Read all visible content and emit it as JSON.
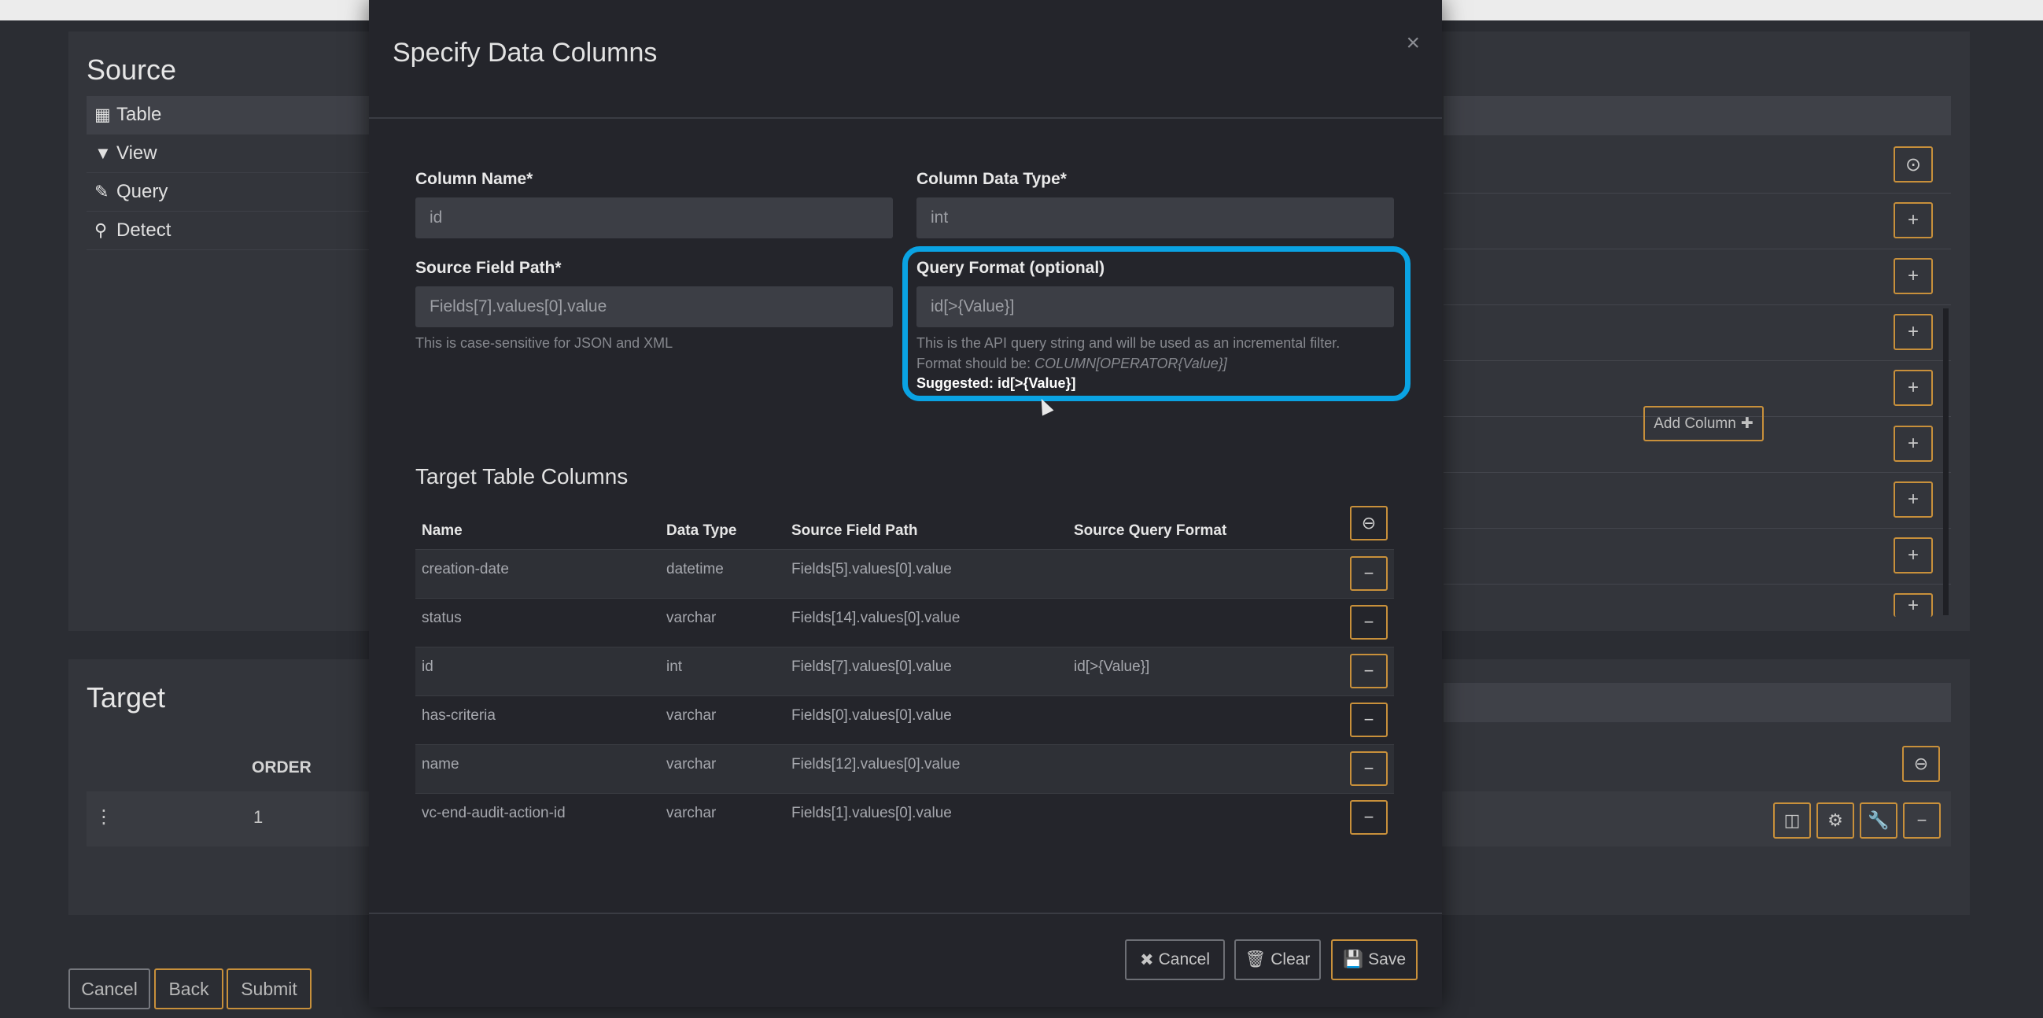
{
  "background": {
    "source": {
      "title": "Source",
      "menu": [
        {
          "icon": "table-icon",
          "glyph": "▦",
          "label": "Table"
        },
        {
          "icon": "filter-icon",
          "glyph": "▼",
          "label": "View"
        },
        {
          "icon": "edit-icon",
          "glyph": "✎",
          "label": "Query"
        },
        {
          "icon": "search-icon",
          "glyph": "⚲",
          "label": "Detect"
        }
      ]
    },
    "target": {
      "title": "Target",
      "order_header": "ORDER",
      "row_order": "1"
    },
    "buttons": {
      "cancel": "Cancel",
      "back": "Back",
      "submit": "Submit"
    }
  },
  "modal": {
    "title": "Specify Data Columns",
    "close": "×",
    "fields": {
      "column_name": {
        "label": "Column Name*",
        "value": "id"
      },
      "column_data_type": {
        "label": "Column Data Type*",
        "value": "int"
      },
      "source_field_path": {
        "label": "Source Field Path*",
        "value": "Fields[7].values[0].value",
        "help": "This is case-sensitive for JSON and XML"
      },
      "query_format": {
        "label": "Query Format (optional)",
        "value": "id[>{Value}]",
        "help_line1": "This is the API query string and will be used as an incremental filter.",
        "help_line2_prefix": "Format should be: ",
        "help_line2_format": "COLUMN[OPERATOR{Value}]",
        "suggested": "Suggested: id[>{Value}]"
      }
    },
    "add_column_label": "Add Column",
    "target_table": {
      "title": "Target Table Columns",
      "headers": [
        "Name",
        "Data Type",
        "Source Field Path",
        "Source Query Format"
      ],
      "rows": [
        {
          "name": "creation-date",
          "type": "datetime",
          "path": "Fields[5].values[0].value",
          "format": ""
        },
        {
          "name": "status",
          "type": "varchar",
          "path": "Fields[14].values[0].value",
          "format": ""
        },
        {
          "name": "id",
          "type": "int",
          "path": "Fields[7].values[0].value",
          "format": "id[>{Value}]"
        },
        {
          "name": "has-criteria",
          "type": "varchar",
          "path": "Fields[0].values[0].value",
          "format": ""
        },
        {
          "name": "name",
          "type": "varchar",
          "path": "Fields[12].values[0].value",
          "format": ""
        },
        {
          "name": "vc-end-audit-action-id",
          "type": "varchar",
          "path": "Fields[1].values[0].value",
          "format": ""
        }
      ]
    },
    "footer": {
      "cancel": "Cancel",
      "clear": "Clear",
      "save": "Save"
    }
  },
  "colors": {
    "accent": "#c8903b",
    "highlight": "#0aa3e3"
  }
}
